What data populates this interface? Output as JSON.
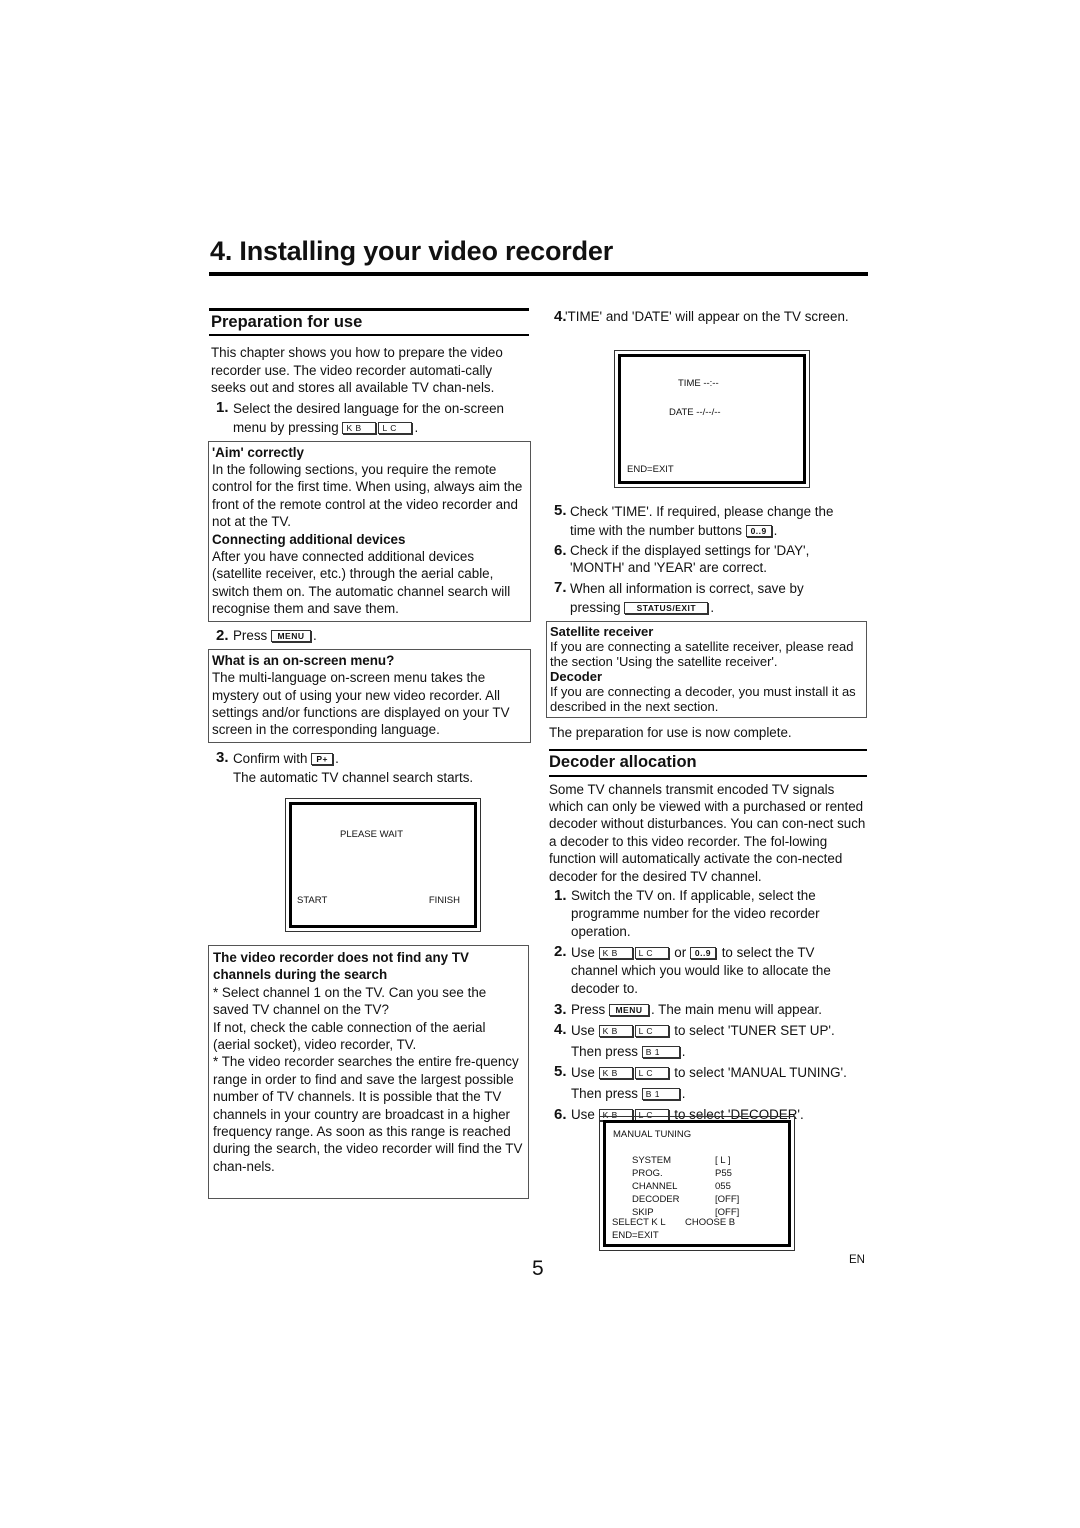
{
  "chapter": {
    "title": "4. Installing your video recorder"
  },
  "preparation": {
    "heading": "Preparation for use",
    "intro": "This chapter shows you how to prepare the video recorder use. The video recorder automati-cally seeks out and stores all available TV chan-nels.",
    "step1": {
      "num": "1.",
      "text_a": "Select the desired language for the on-screen",
      "text_b": "menu by pressing",
      "keys": [
        "K B",
        "L C"
      ],
      "end": "."
    },
    "aim_box": {
      "title": "'Aim' correctly",
      "text": "In the following sections, you require the remote control for the first time. When using, always aim the front of the remote control at the video recorder and not at the TV.",
      "title2": "Connecting additional devices",
      "text2": "After you have connected additional devices (satellite receiver, etc.) through the aerial cable, switch them on. The automatic channel search will recognise them and save them."
    },
    "step2": {
      "num": "2.",
      "text": "Press",
      "key": "MENU",
      "end": "."
    },
    "menu_box": {
      "title": "What is an on-screen menu?",
      "text": "The multi-language on-screen menu takes the mystery out of using your new video recorder. All settings and/or functions are displayed on your TV screen in the corresponding language."
    },
    "step3": {
      "num": "3.",
      "text": "Confirm with",
      "key": "P+",
      "end": ".",
      "sub": "The automatic TV channel search starts."
    },
    "search_screen": {
      "message": "PLEASE WAIT",
      "start": "START",
      "finish": "FINISH"
    },
    "trouble_box": {
      "title": "The video recorder does not find any TV channels during the search",
      "p1": "* Select channel 1 on the TV. Can you see the saved TV channel on the TV?",
      "p2": "If not, check the cable connection of the aerial (aerial socket), video recorder, TV.",
      "p3": "* The video recorder searches the entire fre-quency range in order to find and save the largest possible number of TV channels. It is possible that the TV channels in your country are broadcast in a higher frequency range. As soon as this range is reached during the search, the video recorder will find the TV chan-nels."
    },
    "step4": {
      "num": "4.",
      "text": "'TIME' and 'DATE' will appear on the TV screen."
    },
    "time_screen": {
      "time": "TIME --:--",
      "date": "DATE --/--/--",
      "exit": "END=EXIT"
    },
    "step5": {
      "num": "5.",
      "text_a": "Check 'TIME'. If required, please change the",
      "text_b": "time with the number buttons",
      "key": "0..9",
      "end": "."
    },
    "step6": {
      "num": "6.",
      "text": "Check if the displayed settings for 'DAY', 'MONTH' and 'YEAR' are correct."
    },
    "step7": {
      "num": "7.",
      "text_a": "When all information is correct, save by",
      "text_b": "pressing",
      "key": "STATUS/EXIT",
      "end": "."
    },
    "sat_box": {
      "title": "Satellite receiver",
      "text": "If you are connecting a satellite receiver, please read the section 'Using the satellite receiver'.",
      "title2": "Decoder",
      "text2": "If you are connecting a decoder, you must install it as described in the next section."
    },
    "complete": "The preparation for use is now complete."
  },
  "decoder": {
    "heading": "Decoder allocation",
    "intro": "Some TV channels transmit encoded TV signals which can only be viewed with a purchased or rented decoder without disturbances. You can con-nect such a decoder to this video recorder. The fol-lowing function will automatically activate the con-nected decoder for the desired TV channel.",
    "step1": {
      "num": "1.",
      "text": "Switch the TV on. If applicable, select the programme number for the video recorder operation."
    },
    "step2": {
      "num": "2.",
      "use": "Use",
      "keys": [
        "K B",
        "L C"
      ],
      "or": "or",
      "key_num": "0..9",
      "text_a": "to select the TV",
      "text_b": "channel which you would like to allocate the decoder to."
    },
    "step3": {
      "num": "3.",
      "text": "Press",
      "key": "MENU",
      "end": ". The main menu will appear."
    },
    "step4": {
      "num": "4.",
      "use": "Use",
      "keys": [
        "K B",
        "L C"
      ],
      "text": "to select 'TUNER SET UP'.",
      "then": "Then press",
      "key_then": "B 1",
      "end": "."
    },
    "step5": {
      "num": "5.",
      "use": "Use",
      "keys": [
        "K B",
        "L C"
      ],
      "text": "to select 'MANUAL TUNING'.",
      "then": "Then press",
      "key_then": "B 1",
      "end": "."
    },
    "step6": {
      "num": "6.",
      "use": "Use",
      "keys": [
        "K B",
        "L C"
      ],
      "text": "to select 'DECODER'."
    },
    "manual_tuning_screen": {
      "title": "MANUAL TUNING",
      "rows": [
        {
          "label": "SYSTEM",
          "value": "[ L ]"
        },
        {
          "label": "PROG.",
          "value": "P55"
        },
        {
          "label": "CHANNEL",
          "value": "055"
        },
        {
          "label": "DECODER",
          "value": "[OFF]"
        },
        {
          "label": "SKIP",
          "value": "[OFF]"
        }
      ],
      "select": "SELECT K L",
      "choose": "CHOOSE B",
      "exit": "END=EXIT"
    }
  },
  "footer": {
    "page_number": "5",
    "language": "EN"
  }
}
